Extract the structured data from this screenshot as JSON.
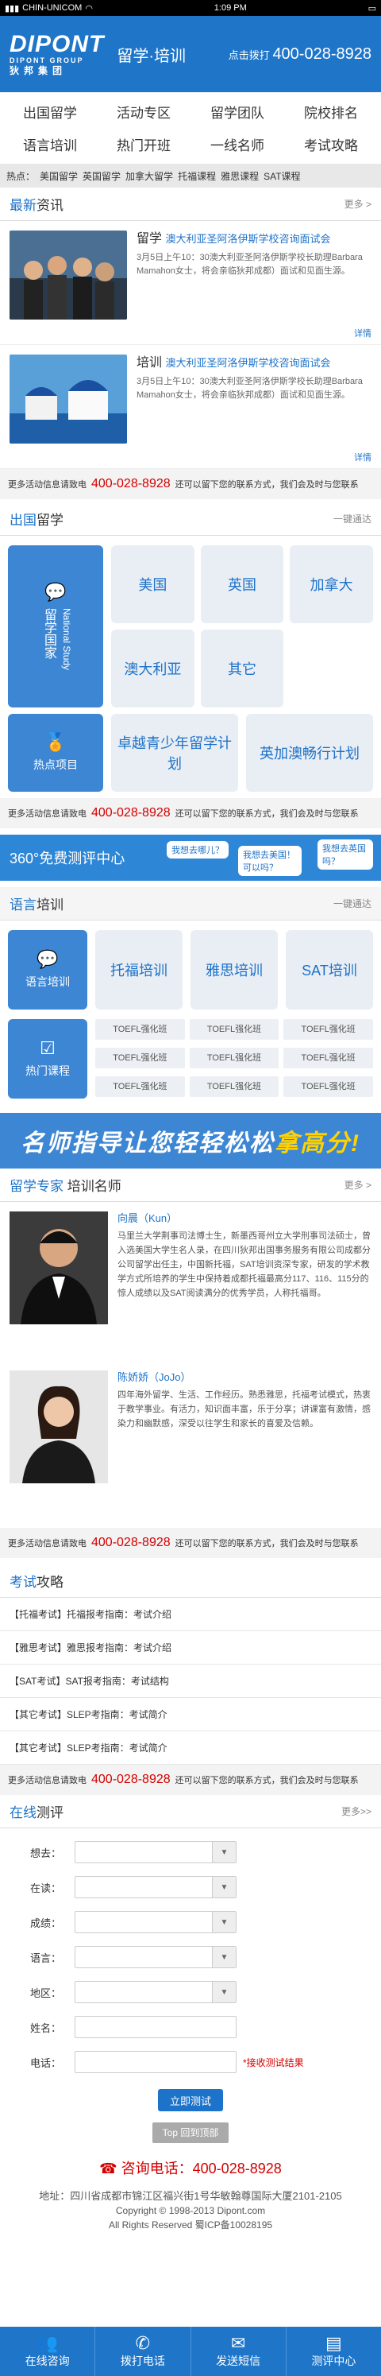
{
  "status": {
    "carrier": "CHIN-UNICOM",
    "time": "1:09 PM"
  },
  "header": {
    "logo": "DIPONT",
    "logo_sub": "DIPONT GROUP",
    "logo_cn": "狄邦集团",
    "site": "留学·培训",
    "hotline_label": "点击拨打",
    "hotline": "400-028-8928"
  },
  "nav": [
    "出国留学",
    "活动专区",
    "留学团队",
    "院校排名",
    "语言培训",
    "热门开班",
    "一线名师",
    "考试攻略"
  ],
  "hot": {
    "label": "热点：",
    "items": [
      "美国留学",
      "英国留学",
      "加拿大留学",
      "托福课程",
      "雅思课程",
      "SAT课程"
    ]
  },
  "news": {
    "title_a": "最新",
    "title_b": "资讯",
    "more": "更多 >",
    "items": [
      {
        "tag": "留学",
        "sub": "澳大利亚圣阿洛伊斯学校咨询面试会",
        "text": "3月5日上午10：30澳大利亚圣阿洛伊斯学校长助理Barbara Mamahon女士，将会亲临狄邦成都）面试和见面生源。",
        "detail": "详情"
      },
      {
        "tag": "培训",
        "sub": "澳大利亚圣阿洛伊斯学校咨询面试会",
        "text": "3月5日上午10：30澳大利亚圣阿洛伊斯学校长助理Barbara Mamahon女士，将会亲临狄邦成都）面试和见面生源。",
        "detail": "详情"
      }
    ]
  },
  "call": {
    "prefix": "更多活动信息请致电",
    "phone": "400-028-8928",
    "suffix": "还可以留下您的联系方式，我们会及时与您联系"
  },
  "study": {
    "title_a": "出国",
    "title_b": "留学",
    "right": "一键通达",
    "big": {
      "cn": "留学国家",
      "en": "National Study"
    },
    "countries": [
      "美国",
      "英国",
      "加拿大",
      "澳大利亚",
      "其它"
    ],
    "hot_label": "热点项目",
    "projects": [
      "卓越青少年留学计划",
      "英加澳畅行计划"
    ]
  },
  "banner360": {
    "text": "360°免费测评中心",
    "q1": "我想去哪儿？",
    "q2": "我想去美国！可以吗？",
    "q3": "我想去英国吗？"
  },
  "lang": {
    "title_a": "语言",
    "title_b": "培训",
    "right": "一键通达",
    "big": "语言培训",
    "courses": [
      "托福培训",
      "雅思培训",
      "SAT培训"
    ],
    "hot_label": "热门课程",
    "classes": [
      "TOEFL强化班",
      "TOEFL强化班",
      "TOEFL强化班",
      "TOEFL强化班",
      "TOEFL强化班",
      "TOEFL强化班",
      "TOEFL强化班",
      "TOEFL强化班",
      "TOEFL强化班"
    ]
  },
  "slogan": {
    "a": "名师指导让您轻轻松松",
    "b": "拿高分!"
  },
  "teachers": {
    "title_a": "留学专家",
    "title_b": "培训名师",
    "more": "更多 >",
    "list": [
      {
        "name": "向晨（Kun）",
        "bio": "马里兰大学荆事司法博士生，新墨西哥州立大学刑事司法硕士，曾入选美国大学生名人录，在四川狄邦出国事务服务有限公司成都分公司留学出任主，中国新托福，SAT培训资深专家，研发的学术教学方式所培养的学生中保持着成都托福最高分117、116、115分的惊人成绩以及SAT阅读满分的优秀学员，人称托福哥。"
      },
      {
        "name": "陈娇娇（JoJo）",
        "bio": "四年海外留学、生活、工作经历。熟悉雅思，托福考试模式，热衷于教学事业。有活力，知识面丰富，乐于分享；讲课富有激情，感染力和幽默感，深受以往学生和家长的喜爱及信赖。"
      }
    ]
  },
  "exam": {
    "title_a": "考试",
    "title_b": "攻略",
    "items": [
      "【托福考试】托福报考指南：考试介绍",
      "【雅思考试】雅思报考指南：考试介绍",
      "【SAT考试】SAT报考指南：考试结构",
      "【其它考试】SLEP考指南：考试简介",
      "【其它考试】SLEP考指南：考试简介"
    ]
  },
  "test": {
    "title_a": "在线",
    "title_b": "测评",
    "more": "更多>>",
    "fields": [
      "想去：",
      "在读：",
      "成绩：",
      "语言：",
      "地区："
    ],
    "name_label": "姓名：",
    "phone_label": "电话：",
    "phone_note": "*接收测试结果",
    "submit": "立即测试"
  },
  "footer": {
    "totop": "Top 回到顶部",
    "phone": "咨询电话：400-028-8928",
    "addr": "地址：四川省成都市锦江区福兴街1号华敏翰尊国际大厦2101-2105",
    "copyright": "Copyright © 1998-2013 Dipont.com",
    "icp": "All Rights Reserved 蜀ICP备10028195"
  },
  "bottom_nav": [
    "在线咨询",
    "拨打电话",
    "发送短信",
    "测评中心"
  ]
}
